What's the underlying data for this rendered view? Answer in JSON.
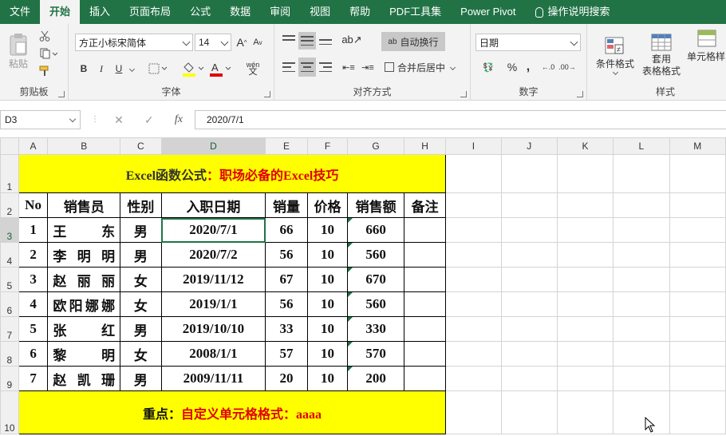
{
  "tabs": [
    "文件",
    "开始",
    "插入",
    "页面布局",
    "公式",
    "数据",
    "审阅",
    "视图",
    "帮助",
    "PDF工具集",
    "Power Pivot",
    "操作说明搜索"
  ],
  "active_tab": "开始",
  "ribbon": {
    "clipboard": {
      "paste": "粘贴",
      "label": "剪贴板"
    },
    "font": {
      "name": "方正小标宋简体",
      "size": "14",
      "label": "字体",
      "bold": "B",
      "italic": "I",
      "underline": "U",
      "grow": "A",
      "shrink": "A",
      "phonetic": "wén",
      "color_highlight": "#ffff00",
      "color_font": "#e00000"
    },
    "align": {
      "wrap": "自动换行",
      "merge": "合并后居中",
      "label": "对齐方式"
    },
    "number": {
      "format": "日期",
      "percent": "%",
      "comma": ",",
      "label": "数字"
    },
    "styles": {
      "conditional": "条件格式",
      "table1": "套用",
      "table2": "表格格式",
      "cell": "单元格样",
      "label": "样式"
    }
  },
  "formula_bar": {
    "name_box": "D3",
    "cancel": "✕",
    "enter": "✓",
    "fx": "fx",
    "content": "2020/7/1"
  },
  "columns": [
    "A",
    "B",
    "C",
    "D",
    "E",
    "F",
    "G",
    "H",
    "I",
    "J",
    "K",
    "L",
    "M"
  ],
  "rows": [
    "1",
    "2",
    "3",
    "4",
    "5",
    "6",
    "7",
    "8",
    "9",
    "10"
  ],
  "sheet": {
    "title_black": "Excel函数公式",
    "title_red": "：职场必备的Excel技巧",
    "headers": [
      "No",
      "销售员",
      "性别",
      "入职日期",
      "销量",
      "价格",
      "销售额",
      "备注"
    ],
    "data": [
      [
        "1",
        "王东",
        "男",
        "2020/7/1",
        "66",
        "10",
        "660",
        ""
      ],
      [
        "2",
        "李明明",
        "男",
        "2020/7/2",
        "56",
        "10",
        "560",
        ""
      ],
      [
        "3",
        "赵丽丽",
        "女",
        "2019/11/12",
        "67",
        "10",
        "670",
        ""
      ],
      [
        "4",
        "欧阳娜娜",
        "女",
        "2019/1/1",
        "56",
        "10",
        "560",
        ""
      ],
      [
        "5",
        "张红",
        "男",
        "2019/10/10",
        "33",
        "10",
        "330",
        ""
      ],
      [
        "6",
        "黎明",
        "女",
        "2008/1/1",
        "57",
        "10",
        "570",
        ""
      ],
      [
        "7",
        "赵凯珊",
        "男",
        "2009/11/11",
        "20",
        "10",
        "200",
        ""
      ]
    ],
    "footer_black": "重点：",
    "footer_red": "自定义单元格格式：aaaa"
  },
  "colors": {
    "accent": "#217346",
    "highlight": "#ffff00",
    "red": "#e00000"
  }
}
